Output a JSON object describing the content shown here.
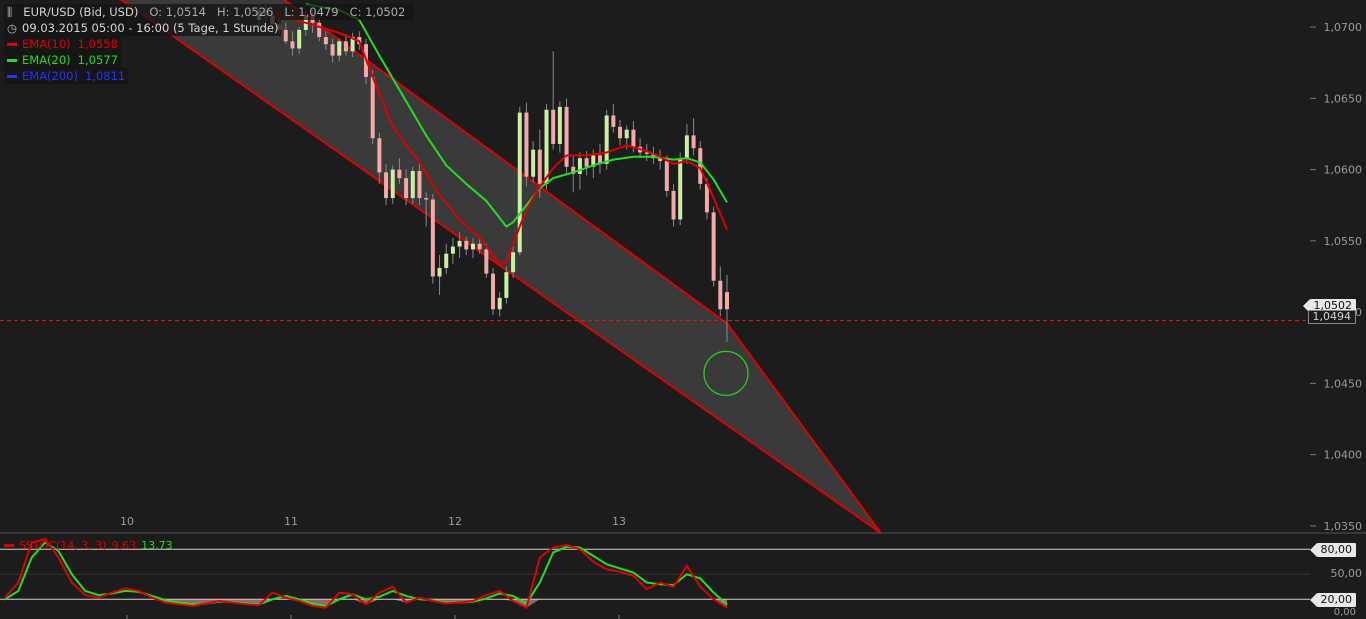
{
  "header": {
    "symbol": "EUR/USD (Bid, USD)",
    "ohlc": {
      "open": "O: 1,0514",
      "high": "H: 1,0526",
      "low": "L: 1,0479",
      "close": "C: 1,0502"
    },
    "period": "09.03.2015 05:00 - 16:00 (5 Tage, 1 Stunde)"
  },
  "indicators": [
    {
      "label": "EMA(10)",
      "value": "1,0558",
      "color": "#e00000"
    },
    {
      "label": "EMA(20)",
      "value": "1,0577",
      "color": "#22dd22"
    },
    {
      "label": "EMA(200)",
      "value": "1,0811",
      "color": "#2233ff"
    }
  ],
  "stoch_legend": {
    "label": "SSTOC(14, 3, 3)",
    "k_value": "9,63",
    "d_value": "13,73",
    "k_color": "#e00000",
    "d_color": "#22dd22"
  },
  "price_tags": {
    "last": "1,0502",
    "reference": "1,0494"
  },
  "stoch_axis": {
    "upper": "80,00",
    "middle": "50,00",
    "lower": "20,00",
    "zero": "0,00"
  },
  "colors": {
    "background": "#1c1c1c",
    "channel_line": "#e00000",
    "channel_fill": "#3a3a3a",
    "bull": "#c8f0a0",
    "bear": "#f4a8a8",
    "ema10": "#e00000",
    "ema20": "#22dd22",
    "circle": "#22cc22"
  },
  "chart_data": [
    {
      "type": "candlestick",
      "title": "",
      "x_tick_labels": [
        "10",
        "11",
        "12",
        "13"
      ],
      "y_tick_labels": [
        "1,0700",
        "1,0650",
        "1,0600",
        "1,0550",
        "1,0500",
        "1,0450",
        "1,0400",
        "1,0350"
      ],
      "y_ticks": [
        1.07,
        1.065,
        1.06,
        1.055,
        1.05,
        1.045,
        1.04,
        1.035
      ],
      "ylim": [
        1.0345,
        1.0719
      ],
      "xlim": [
        0,
        108
      ],
      "reference_line": 1.0494,
      "candles": [
        [
          38.0,
          1.0705,
          1.0716,
          1.0696,
          1.0712
        ],
        [
          39.0,
          1.0712,
          1.0716,
          1.0703,
          1.0708
        ],
        [
          40.0,
          1.0708,
          1.0712,
          1.0696,
          1.0702
        ],
        [
          41.0,
          1.0702,
          1.0706,
          1.0695,
          1.0698
        ],
        [
          42.0,
          1.0698,
          1.0703,
          1.0688,
          1.069
        ],
        [
          43.0,
          1.069,
          1.0697,
          1.068,
          1.0685
        ],
        [
          44.0,
          1.0685,
          1.07,
          1.0681,
          1.0698
        ],
        [
          45.0,
          1.0698,
          1.0712,
          1.0694,
          1.0708
        ],
        [
          46.0,
          1.0708,
          1.0712,
          1.0696,
          1.0703
        ],
        [
          47.0,
          1.0703,
          1.0706,
          1.069,
          1.0693
        ],
        [
          48.0,
          1.0693,
          1.0697,
          1.0684,
          1.0688
        ],
        [
          49.0,
          1.0688,
          1.0692,
          1.0675,
          1.068
        ],
        [
          50.0,
          1.068,
          1.0692,
          1.0676,
          1.069
        ],
        [
          51.0,
          1.069,
          1.0695,
          1.068,
          1.0683
        ],
        [
          52.0,
          1.0683,
          1.0696,
          1.0679,
          1.0693
        ],
        [
          53.0,
          1.0693,
          1.0697,
          1.0684,
          1.0688
        ],
        [
          54.0,
          1.0688,
          1.0692,
          1.066,
          1.0665
        ],
        [
          55.0,
          1.0665,
          1.067,
          1.0618,
          1.0622
        ],
        [
          56.0,
          1.0622,
          1.0626,
          1.059,
          1.0598
        ],
        [
          57.0,
          1.0598,
          1.0604,
          1.0575,
          1.058
        ],
        [
          58.0,
          1.058,
          1.0603,
          1.0576,
          1.06
        ],
        [
          59.0,
          1.06,
          1.0608,
          1.059,
          1.0594
        ],
        [
          60.0,
          1.0594,
          1.06,
          1.0575,
          1.058
        ],
        [
          61.0,
          1.058,
          1.0602,
          1.0576,
          1.0599
        ],
        [
          62.0,
          1.0599,
          1.0604,
          1.0575,
          1.058
        ],
        [
          63.0,
          1.058,
          1.0584,
          1.056,
          1.0579
        ],
        [
          64.0,
          1.0579,
          1.0583,
          1.052,
          1.0525
        ],
        [
          65.0,
          1.0525,
          1.054,
          1.0512,
          1.0531
        ],
        [
          66.0,
          1.0531,
          1.0548,
          1.0527,
          1.0541
        ],
        [
          67.0,
          1.0541,
          1.0552,
          1.0534,
          1.0546
        ],
        [
          68.0,
          1.0546,
          1.0556,
          1.0538,
          1.055
        ],
        [
          69.0,
          1.055,
          1.0553,
          1.054,
          1.0544
        ],
        [
          70.0,
          1.0544,
          1.0552,
          1.0538,
          1.0548
        ],
        [
          71.0,
          1.0548,
          1.0552,
          1.0541,
          1.0544
        ],
        [
          72.0,
          1.0544,
          1.0548,
          1.0524,
          1.0527
        ],
        [
          73.0,
          1.0527,
          1.0531,
          1.0498,
          1.0502
        ],
        [
          74.0,
          1.0502,
          1.0514,
          1.0497,
          1.051
        ],
        [
          75.0,
          1.051,
          1.0532,
          1.0506,
          1.0528
        ],
        [
          76.0,
          1.0528,
          1.0546,
          1.0524,
          1.0542
        ],
        [
          77.0,
          1.0542,
          1.0644,
          1.054,
          1.064
        ],
        [
          78.0,
          1.064,
          1.0647,
          1.0588,
          1.0595
        ],
        [
          79.0,
          1.0595,
          1.062,
          1.0591,
          1.0614
        ],
        [
          80.0,
          1.0614,
          1.0628,
          1.058,
          1.059
        ],
        [
          81.0,
          1.059,
          1.0646,
          1.0586,
          1.0642
        ],
        [
          82.0,
          1.0642,
          1.0683,
          1.0614,
          1.0618
        ],
        [
          83.0,
          1.0618,
          1.0648,
          1.0612,
          1.0644
        ],
        [
          84.0,
          1.0644,
          1.065,
          1.0597,
          1.0602
        ],
        [
          85.0,
          1.0602,
          1.061,
          1.0584,
          1.0597
        ],
        [
          86.0,
          1.0597,
          1.0612,
          1.0586,
          1.0608
        ],
        [
          87.0,
          1.0608,
          1.0613,
          1.0596,
          1.0602
        ],
        [
          88.0,
          1.0602,
          1.0614,
          1.0594,
          1.061
        ],
        [
          89.0,
          1.061,
          1.0618,
          1.0597,
          1.0604
        ],
        [
          90.0,
          1.0604,
          1.0642,
          1.06,
          1.0638
        ],
        [
          91.0,
          1.0638,
          1.0646,
          1.0626,
          1.063
        ],
        [
          92.0,
          1.063,
          1.0635,
          1.0617,
          1.0622
        ],
        [
          93.0,
          1.0622,
          1.0631,
          1.0614,
          1.0628
        ],
        [
          94.0,
          1.0628,
          1.0634,
          1.0612,
          1.0616
        ],
        [
          95.0,
          1.0616,
          1.0622,
          1.0609,
          1.0612
        ],
        [
          96.0,
          1.0612,
          1.0618,
          1.0606,
          1.0611
        ],
        [
          97.0,
          1.0611,
          1.0616,
          1.0604,
          1.0608
        ],
        [
          98.0,
          1.0608,
          1.0614,
          1.06,
          1.0606
        ],
        [
          99.0,
          1.0606,
          1.061,
          1.0581,
          1.0585
        ],
        [
          100.0,
          1.0585,
          1.059,
          1.056,
          1.0565
        ],
        [
          101.0,
          1.0565,
          1.0612,
          1.0561,
          1.0608
        ],
        [
          102.0,
          1.0608,
          1.0632,
          1.0604,
          1.0624
        ],
        [
          103.0,
          1.0624,
          1.0636,
          1.061,
          1.0615
        ],
        [
          104.0,
          1.0615,
          1.062,
          1.0586,
          1.059
        ],
        [
          105.0,
          1.059,
          1.0594,
          1.0565,
          1.057
        ],
        [
          106.0,
          1.057,
          1.0574,
          1.0518,
          1.0522
        ],
        [
          107.0,
          1.0522,
          1.0532,
          1.0497,
          1.0502
        ],
        [
          108.0,
          1.0514,
          1.0526,
          1.0479,
          1.0502
        ]
      ],
      "ema10": [
        [
          40,
          1.071
        ],
        [
          45,
          1.0703
        ],
        [
          50,
          1.0696
        ],
        [
          53,
          1.069
        ],
        [
          55,
          1.0665
        ],
        [
          58,
          1.063
        ],
        [
          62,
          1.0605
        ],
        [
          65,
          1.0582
        ],
        [
          68,
          1.0565
        ],
        [
          71,
          1.0552
        ],
        [
          73,
          1.054
        ],
        [
          74,
          1.0533
        ],
        [
          75,
          1.0535
        ],
        [
          76,
          1.0548
        ],
        [
          78,
          1.0572
        ],
        [
          80,
          1.0588
        ],
        [
          82,
          1.0601
        ],
        [
          84,
          1.061
        ],
        [
          87,
          1.061
        ],
        [
          90,
          1.0612
        ],
        [
          93,
          1.0617
        ],
        [
          96,
          1.0613
        ],
        [
          98,
          1.0609
        ],
        [
          100,
          1.0604
        ],
        [
          102,
          1.0606
        ],
        [
          104,
          1.0601
        ],
        [
          106,
          1.058
        ],
        [
          108,
          1.0558
        ]
      ],
      "ema20": [
        [
          45,
          1.0716
        ],
        [
          50,
          1.0712
        ],
        [
          53,
          1.0705
        ],
        [
          56,
          1.068
        ],
        [
          60,
          1.0648
        ],
        [
          63,
          1.0624
        ],
        [
          66,
          1.0603
        ],
        [
          69,
          1.059
        ],
        [
          72,
          1.0578
        ],
        [
          74,
          1.0566
        ],
        [
          75,
          1.056
        ],
        [
          76,
          1.0563
        ],
        [
          78,
          1.0575
        ],
        [
          80,
          1.0587
        ],
        [
          82,
          1.0594
        ],
        [
          85,
          1.0598
        ],
        [
          88,
          1.0603
        ],
        [
          91,
          1.0607
        ],
        [
          94,
          1.0609
        ],
        [
          97,
          1.0609
        ],
        [
          100,
          1.0607
        ],
        [
          102,
          1.0608
        ],
        [
          104,
          1.0605
        ],
        [
          106,
          1.0593
        ],
        [
          108,
          1.0577
        ]
      ],
      "channel": {
        "upper": [
          [
            15,
            1.0811
          ],
          [
            108,
            1.0492
          ],
          [
            131,
            1.0345
          ]
        ],
        "lower": [
          [
            15,
            1.0727
          ],
          [
            131,
            1.0345
          ]
        ]
      },
      "marker_circle": {
        "x": 108,
        "y": 1.0457
      }
    },
    {
      "type": "line",
      "title": "",
      "ylim": [
        0,
        100
      ],
      "levels": [
        80,
        50,
        20
      ],
      "k": [
        [
          0,
          22
        ],
        [
          2,
          40
        ],
        [
          4,
          88
        ],
        [
          6,
          92
        ],
        [
          8,
          70
        ],
        [
          10,
          40
        ],
        [
          12,
          25
        ],
        [
          14,
          22
        ],
        [
          16,
          28
        ],
        [
          18,
          33
        ],
        [
          20,
          30
        ],
        [
          22,
          22
        ],
        [
          24,
          16
        ],
        [
          26,
          14
        ],
        [
          28,
          12
        ],
        [
          30,
          15
        ],
        [
          32,
          18
        ],
        [
          34,
          16
        ],
        [
          36,
          14
        ],
        [
          38,
          13
        ],
        [
          40,
          28
        ],
        [
          42,
          22
        ],
        [
          44,
          18
        ],
        [
          46,
          12
        ],
        [
          48,
          10
        ],
        [
          50,
          28
        ],
        [
          52,
          26
        ],
        [
          54,
          14
        ],
        [
          56,
          28
        ],
        [
          58,
          35
        ],
        [
          60,
          16
        ],
        [
          62,
          22
        ],
        [
          64,
          18
        ],
        [
          66,
          15
        ],
        [
          68,
          16
        ],
        [
          70,
          18
        ],
        [
          72,
          25
        ],
        [
          74,
          30
        ],
        [
          76,
          18
        ],
        [
          78,
          10
        ],
        [
          80,
          70
        ],
        [
          82,
          82
        ],
        [
          84,
          85
        ],
        [
          86,
          80
        ],
        [
          88,
          65
        ],
        [
          90,
          56
        ],
        [
          92,
          53
        ],
        [
          94,
          48
        ],
        [
          96,
          32
        ],
        [
          98,
          40
        ],
        [
          100,
          35
        ],
        [
          102,
          60
        ],
        [
          104,
          35
        ],
        [
          106,
          20
        ],
        [
          108,
          10
        ]
      ],
      "d": [
        [
          0,
          20
        ],
        [
          2,
          30
        ],
        [
          4,
          70
        ],
        [
          6,
          88
        ],
        [
          8,
          78
        ],
        [
          10,
          50
        ],
        [
          12,
          30
        ],
        [
          14,
          25
        ],
        [
          16,
          27
        ],
        [
          18,
          30
        ],
        [
          20,
          29
        ],
        [
          22,
          24
        ],
        [
          24,
          19
        ],
        [
          26,
          16
        ],
        [
          28,
          14
        ],
        [
          30,
          15
        ],
        [
          32,
          17
        ],
        [
          34,
          17
        ],
        [
          36,
          15
        ],
        [
          38,
          14
        ],
        [
          40,
          20
        ],
        [
          42,
          24
        ],
        [
          44,
          20
        ],
        [
          46,
          15
        ],
        [
          48,
          12
        ],
        [
          50,
          20
        ],
        [
          52,
          26
        ],
        [
          54,
          20
        ],
        [
          56,
          23
        ],
        [
          58,
          30
        ],
        [
          60,
          24
        ],
        [
          62,
          20
        ],
        [
          64,
          19
        ],
        [
          66,
          16
        ],
        [
          68,
          16
        ],
        [
          70,
          17
        ],
        [
          72,
          21
        ],
        [
          74,
          27
        ],
        [
          76,
          24
        ],
        [
          78,
          15
        ],
        [
          80,
          40
        ],
        [
          82,
          76
        ],
        [
          84,
          83
        ],
        [
          86,
          82
        ],
        [
          88,
          72
        ],
        [
          90,
          62
        ],
        [
          92,
          57
        ],
        [
          94,
          52
        ],
        [
          96,
          40
        ],
        [
          98,
          38
        ],
        [
          100,
          37
        ],
        [
          102,
          50
        ],
        [
          104,
          45
        ],
        [
          106,
          28
        ],
        [
          108,
          14
        ]
      ]
    }
  ]
}
